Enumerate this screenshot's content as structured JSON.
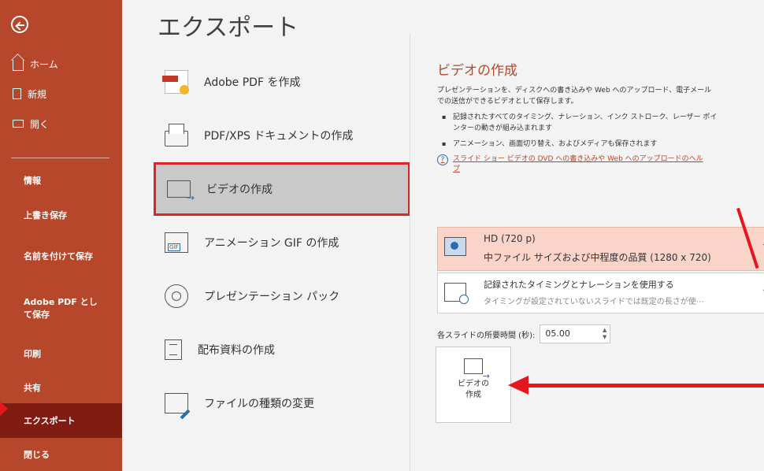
{
  "sidebar": {
    "items_top": [
      {
        "label": "ホーム"
      },
      {
        "label": "新規"
      },
      {
        "label": "開く"
      }
    ],
    "items_bottom": [
      {
        "label": "情報"
      },
      {
        "label": "上書き保存"
      },
      {
        "label": "名前を付けて保存"
      },
      {
        "label": "Adobe PDF として保存"
      },
      {
        "label": "印刷"
      },
      {
        "label": "共有"
      },
      {
        "label": "エクスポート"
      },
      {
        "label": "閉じる"
      }
    ]
  },
  "main": {
    "title": "エクスポート",
    "options": [
      {
        "label": "Adobe PDF を作成"
      },
      {
        "label": "PDF/XPS ドキュメントの作成"
      },
      {
        "label": "ビデオの作成"
      },
      {
        "label": "アニメーション GIF の作成"
      },
      {
        "label": "プレゼンテーション パック"
      },
      {
        "label": "配布資料の作成"
      },
      {
        "label": "ファイルの種類の変更"
      }
    ]
  },
  "detail": {
    "title": "ビデオの作成",
    "desc1": "プレゼンテーションを、ディスクへの書き込みや Web へのアップロード、電子メール",
    "desc2": "での送信ができるビデオとして保存します。",
    "bullet1_line1": "記録されたすべてのタイミング、ナレーション、インク ストローク、レーザー ポイ",
    "bullet1_line2": "ンターの動きが組み込まれます",
    "bullet2": "アニメーション、画面切り替え、およびメディアも保存されます",
    "help_line1": "スライド ショー ビデオの DVD への書き込みや Web へのアップロードのヘル",
    "help_line2": "プ",
    "quality_title": "HD (720 p)",
    "quality_sub": "中ファイル サイズおよび中程度の品質 (1280 x 720)",
    "timing_title": "記録されたタイミングとナレーションを使用する",
    "timing_sub": "タイミングが設定されていないスライドでは既定の長さが使⋯",
    "duration_label": "各スライドの所要時間 (秒):",
    "duration_value": "05.00",
    "create_label1": "ビデオの",
    "create_label2": "作成"
  }
}
